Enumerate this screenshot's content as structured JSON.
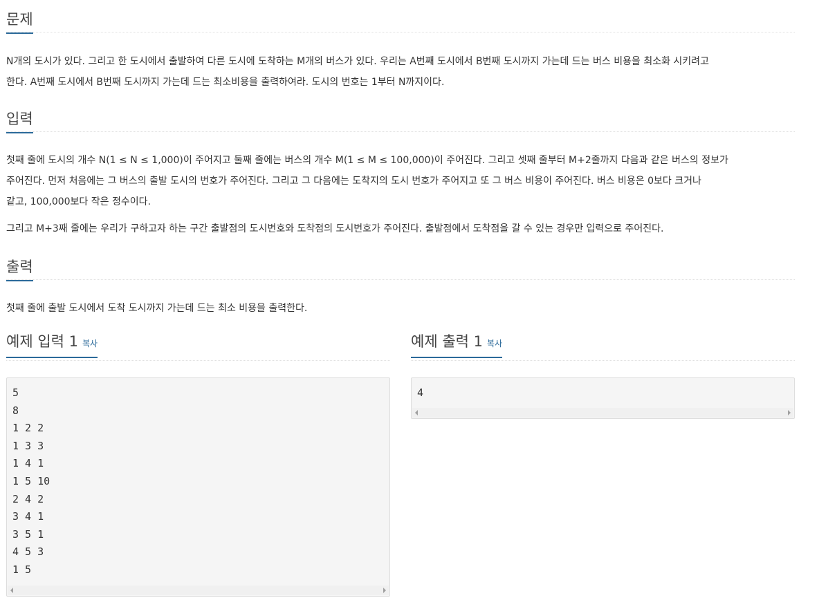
{
  "problem": {
    "title": "문제",
    "lines": [
      "N개의 도시가 있다. 그리고 한 도시에서 출발하여 다른 도시에 도착하는 M개의 버스가 있다. 우리는 A번째 도시에서 B번째 도시까지 가는데 드는 버스 비용을 최소화 시키려고",
      "한다. A번째 도시에서 B번째 도시까지 가는데 드는 최소비용을 출력하여라. 도시의 번호는 1부터 N까지이다."
    ]
  },
  "input": {
    "title": "입력",
    "para1_lines": [
      "첫째 줄에 도시의 개수 N(1 ≤ N ≤ 1,000)이 주어지고 둘째 줄에는 버스의 개수 M(1 ≤ M ≤ 100,000)이 주어진다. 그리고 셋째 줄부터 M+2줄까지 다음과 같은 버스의 정보가",
      "주어진다. 먼저 처음에는 그 버스의 출발 도시의 번호가 주어진다. 그리고 그 다음에는 도착지의 도시 번호가 주어지고 또 그 버스 비용이 주어진다. 버스 비용은 0보다 크거나",
      "같고, 100,000보다 작은 정수이다."
    ],
    "para2": "그리고 M+3째 줄에는 우리가 구하고자 하는 구간 출발점의 도시번호와 도착점의 도시번호가 주어진다. 출발점에서 도착점을 갈 수 있는 경우만 입력으로 주어진다."
  },
  "output": {
    "title": "출력",
    "text": "첫째 줄에 출발 도시에서 도착 도시까지 가는데 드는 최소 비용을 출력한다."
  },
  "sample_input": {
    "title": "예제 입력 1",
    "copy_label": "복사",
    "lines": [
      "5",
      "8",
      "1 2 2",
      "1 3 3",
      "1 4 1",
      "1 5 10",
      "2 4 2",
      "3 4 1",
      "3 5 1",
      "4 5 3",
      "1 5"
    ]
  },
  "sample_output": {
    "title": "예제 출력 1",
    "copy_label": "복사",
    "lines": [
      "4"
    ]
  },
  "colors": {
    "accent": "#2b6a9a",
    "pre_bg": "#f5f5f5",
    "text": "#333333"
  }
}
